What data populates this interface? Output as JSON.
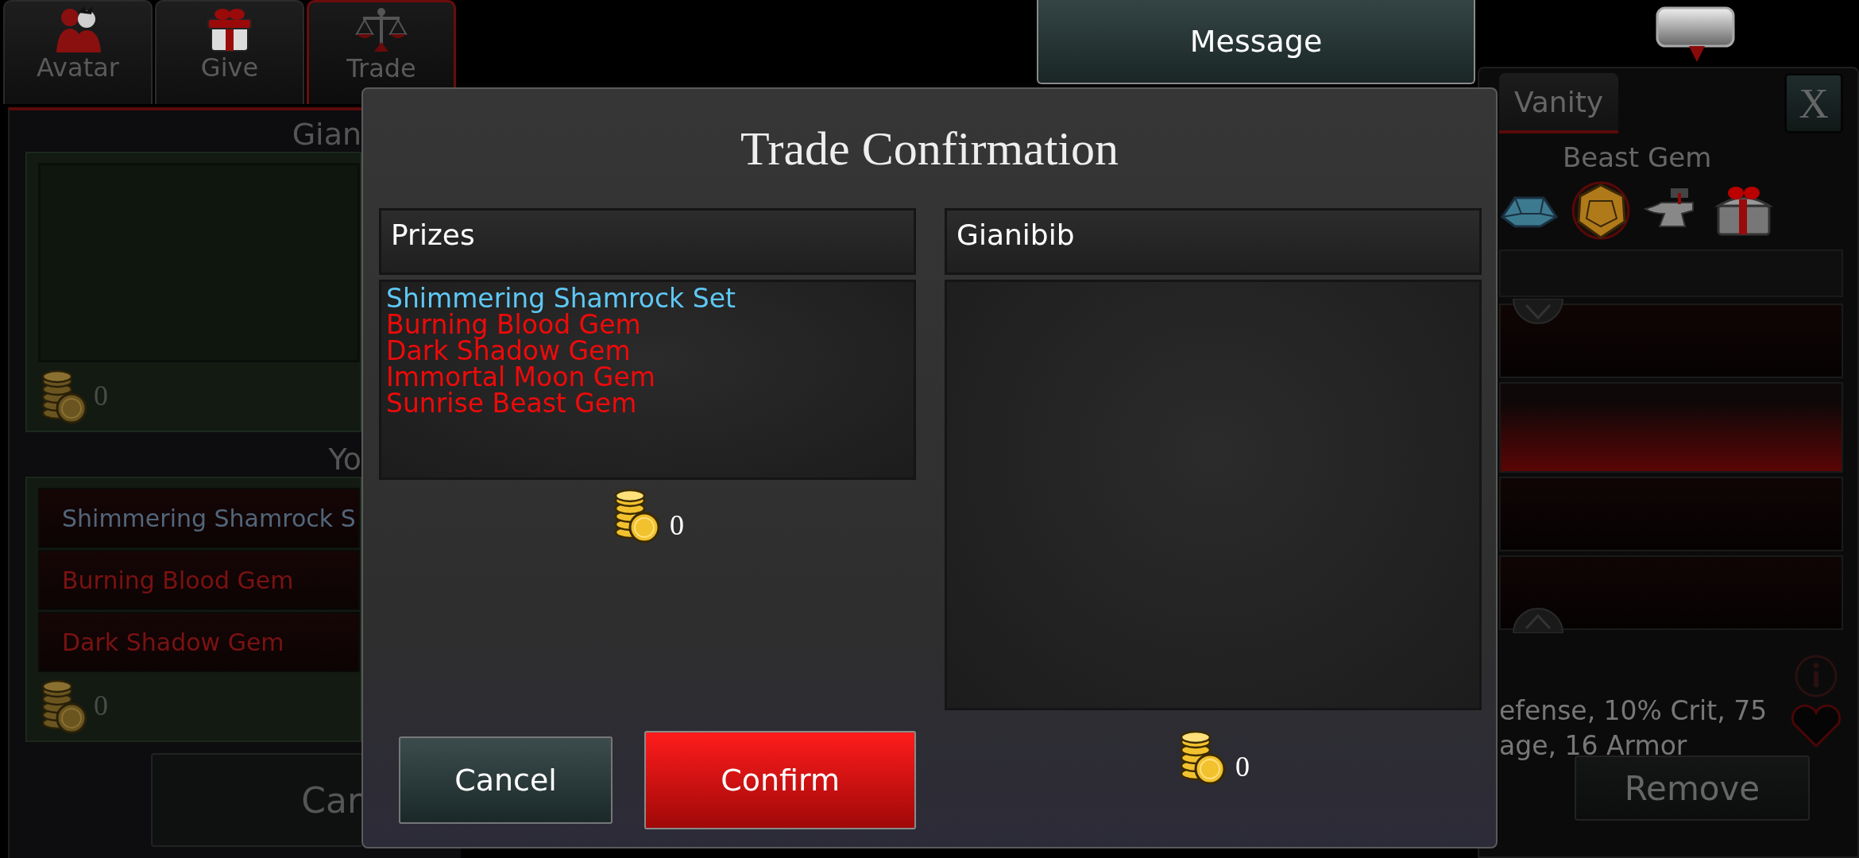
{
  "left_panel": {
    "tabs": [
      {
        "label": "Avatar",
        "selected": false
      },
      {
        "label": "Give",
        "selected": false
      },
      {
        "label": "Trade",
        "selected": true
      }
    ],
    "their_offer": {
      "heading": "Gian",
      "coins": "0"
    },
    "your_offer": {
      "heading": "Yo",
      "items": [
        {
          "name": "Shimmering Shamrock S",
          "color": "#52667a"
        },
        {
          "name": "Burning Blood Gem",
          "color": "#7a1212"
        },
        {
          "name": "Dark Shadow Gem",
          "color": "#7a1212"
        }
      ],
      "coins": "0"
    },
    "cancel_button": "Car"
  },
  "message_button": "Message",
  "right_panel": {
    "tab": {
      "label": "Vanity",
      "selected": true
    },
    "close_button": "X",
    "item_name": "Beast Gem",
    "gems": [
      {
        "kind": "blue-gem",
        "selected": false
      },
      {
        "kind": "orange-gem",
        "selected": true
      },
      {
        "kind": "anvil",
        "selected": false
      },
      {
        "kind": "gift-chest",
        "selected": false
      }
    ],
    "list_rows": [
      {
        "selected": false
      },
      {
        "selected": true
      },
      {
        "selected": false
      },
      {
        "selected": false
      }
    ],
    "stats": [
      "efense, 10% Crit, 75",
      "age, 16 Armor"
    ],
    "remove_button": "Remove"
  },
  "dialog": {
    "title": "Trade Confirmation",
    "columns": [
      {
        "heading": "Prizes",
        "items": [
          {
            "name": "Shimmering Shamrock Set",
            "color": "#5ec8f5"
          },
          {
            "name": "Burning Blood Gem",
            "color": "#ee0a0a"
          },
          {
            "name": "Dark Shadow Gem",
            "color": "#ee0a0a"
          },
          {
            "name": "Immortal Moon Gem",
            "color": "#ee0a0a"
          },
          {
            "name": "Sunrise Beast Gem",
            "color": "#ee0a0a"
          }
        ],
        "coins": "0"
      },
      {
        "heading": "Gianibib",
        "coins": "0"
      }
    ],
    "buttons": [
      {
        "label": "Cancel",
        "kind": "cancel"
      },
      {
        "label": "Confirm",
        "kind": "confirm"
      }
    ]
  }
}
